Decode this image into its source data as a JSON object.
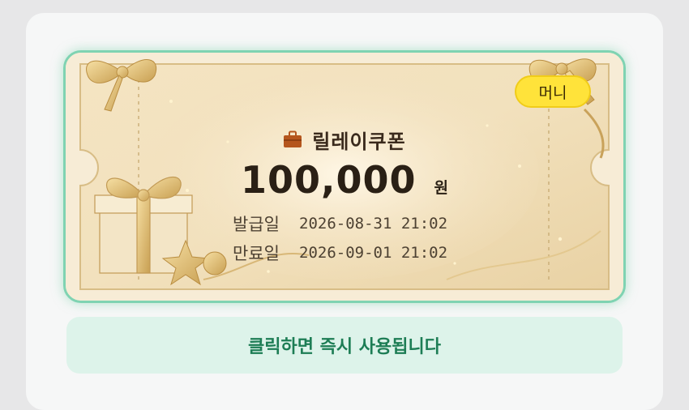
{
  "coupon": {
    "badge": "머니",
    "icon": "briefcase-icon",
    "title": "릴레이쿠폰",
    "amount": "100,000",
    "unit": "원",
    "issue_label": "발급일",
    "issue_date": "2026-08-31 21:02",
    "expire_label": "만료일",
    "expire_date": "2026-09-01 21:02"
  },
  "action": {
    "label": "클릭하면 즉시 사용됩니다"
  },
  "colors": {
    "accent": "#7fd3b2",
    "badge": "#ffe33a",
    "action_bg": "#ddf3ea",
    "action_text": "#1d7d55",
    "ticket": "#efdcb6"
  }
}
